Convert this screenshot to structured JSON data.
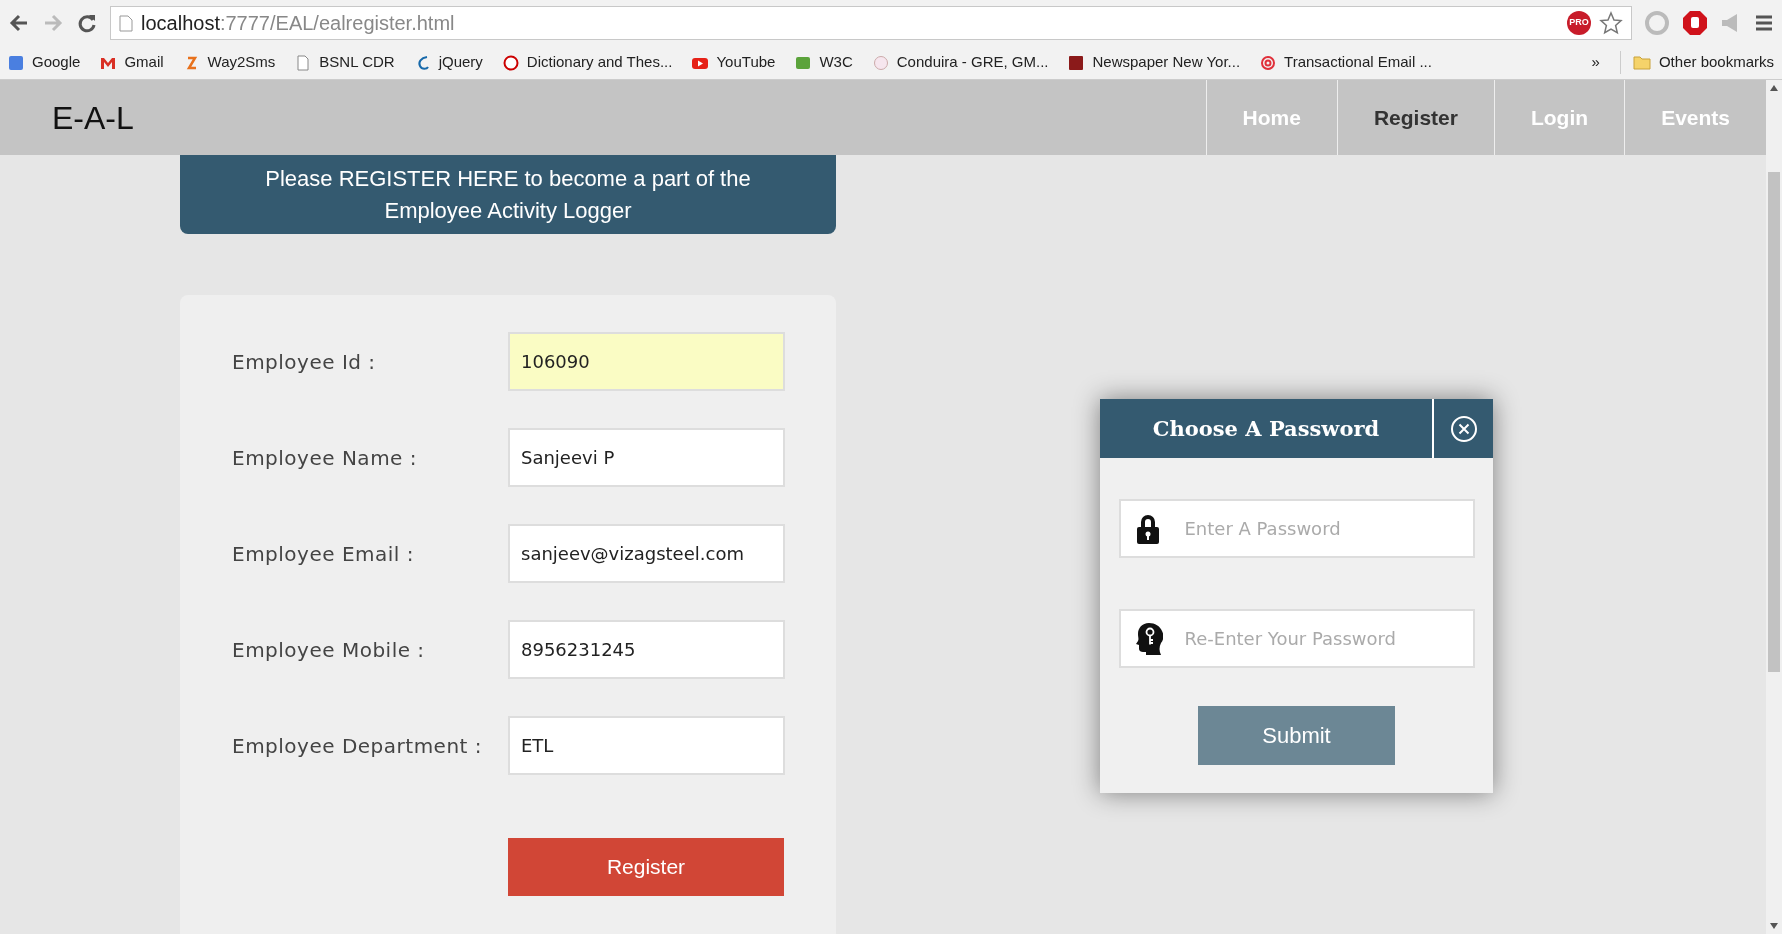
{
  "browser": {
    "url": {
      "host": "localhost",
      "path": ":7777/EAL/ealregister.html"
    },
    "bookmarks": [
      {
        "label": "Google"
      },
      {
        "label": "Gmail"
      },
      {
        "label": "Way2Sms"
      },
      {
        "label": "BSNL CDR"
      },
      {
        "label": "jQuery"
      },
      {
        "label": "Dictionary and Thes..."
      },
      {
        "label": "YouTube"
      },
      {
        "label": "W3C"
      },
      {
        "label": "Conduira - GRE, GM..."
      },
      {
        "label": "Newspaper New Yor..."
      },
      {
        "label": "Transactional Email ..."
      }
    ],
    "more": "»",
    "other_bookmarks": "Other bookmarks",
    "extension_badge": "PRO"
  },
  "navbar": {
    "brand": "E-A-L",
    "items": [
      {
        "label": "Home",
        "selected": false
      },
      {
        "label": "Register",
        "selected": true
      },
      {
        "label": "Login",
        "selected": false
      },
      {
        "label": "Events",
        "selected": false
      }
    ]
  },
  "banner": "Please REGISTER HERE to become a part of the Employee Activity Logger",
  "form": {
    "fields": [
      {
        "label": "Employee Id :",
        "value": "106090",
        "focused": true
      },
      {
        "label": "Employee Name :",
        "value": "Sanjeevi P",
        "focused": false
      },
      {
        "label": "Employee Email :",
        "value": "sanjeev@vizagsteel.com",
        "focused": false
      },
      {
        "label": "Employee Mobile :",
        "value": "8956231245",
        "focused": false
      },
      {
        "label": "Employee Department :",
        "value": "ETL",
        "focused": false
      }
    ],
    "submit": "Register"
  },
  "dialog": {
    "title": "Choose A Password",
    "fields": [
      {
        "kind": "lock",
        "placeholder": "Enter A Password"
      },
      {
        "kind": "recall",
        "placeholder": "Re-Enter Your Password"
      }
    ],
    "submit": "Submit"
  }
}
